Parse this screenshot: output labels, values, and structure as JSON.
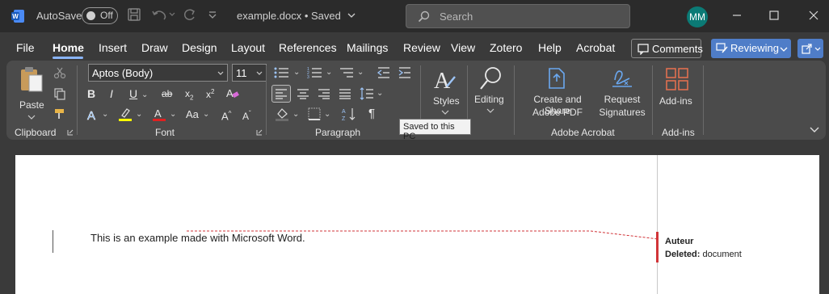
{
  "titlebar": {
    "autosave_label": "AutoSave",
    "autosave_state": "Off",
    "doc_title": "example.docx • Saved",
    "search_placeholder": "Search",
    "avatar_initials": "MM"
  },
  "tabs": [
    "File",
    "Home",
    "Insert",
    "Draw",
    "Design",
    "Layout",
    "References",
    "Mailings",
    "Review",
    "View",
    "Zotero",
    "Help",
    "Acrobat"
  ],
  "active_tab": "Home",
  "tab_buttons": {
    "comments": "Comments",
    "reviewing": "Reviewing"
  },
  "ribbon": {
    "clipboard": {
      "paste_label": "Paste",
      "group_label": "Clipboard"
    },
    "font": {
      "font_name": "Aptos (Body)",
      "font_size": "11",
      "group_label": "Font"
    },
    "paragraph": {
      "group_label": "Paragraph"
    },
    "styles": {
      "label": "Styles"
    },
    "editing": {
      "label": "Editing"
    },
    "acrobat": {
      "create_line1": "Create and Share",
      "create_line2": "Adobe PDF",
      "request_line1": "Request",
      "request_line2": "Signatures",
      "group_label": "Adobe Acrobat"
    },
    "addins": {
      "label": "Add-ins",
      "group_label": "Add-ins"
    },
    "tooltip": "Saved to this PC"
  },
  "document": {
    "body_text": "This is an example made with Microsoft Word.",
    "comment_author": "Auteur",
    "comment_action": "Deleted:",
    "comment_value": "document"
  },
  "colors": {
    "accent_blue": "#4f7dc8",
    "tab_underline": "#8ab4f8",
    "track_change_red": "#d13438",
    "avatar_teal": "#0b7a75"
  }
}
